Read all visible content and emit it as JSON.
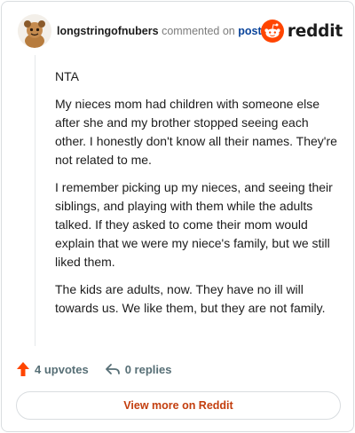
{
  "header": {
    "username": "longstringofnubers",
    "commented_text": "commented on",
    "post_link": "post",
    "brand": "reddit"
  },
  "comment": {
    "paragraphs": [
      "NTA",
      "My nieces mom had children with someone else after she and my brother stopped seeing each other. I honestly don't know all their names. They're not related to me.",
      "I remember picking up my nieces, and seeing their siblings, and playing with them while the adults talked. If they asked to come their mom would explain that we were my niece's family, but we still liked them.",
      "The kids are adults, now. They have no ill will towards us. We like them, but they are not family."
    ]
  },
  "actions": {
    "upvotes": "4 upvotes",
    "replies": "0 replies"
  },
  "footer": {
    "view_more": "View more on Reddit"
  },
  "colors": {
    "brand_orange": "#ff4500",
    "upvote": "#ff4500",
    "link": "#0a449b",
    "view_more": "#c33e0e"
  }
}
